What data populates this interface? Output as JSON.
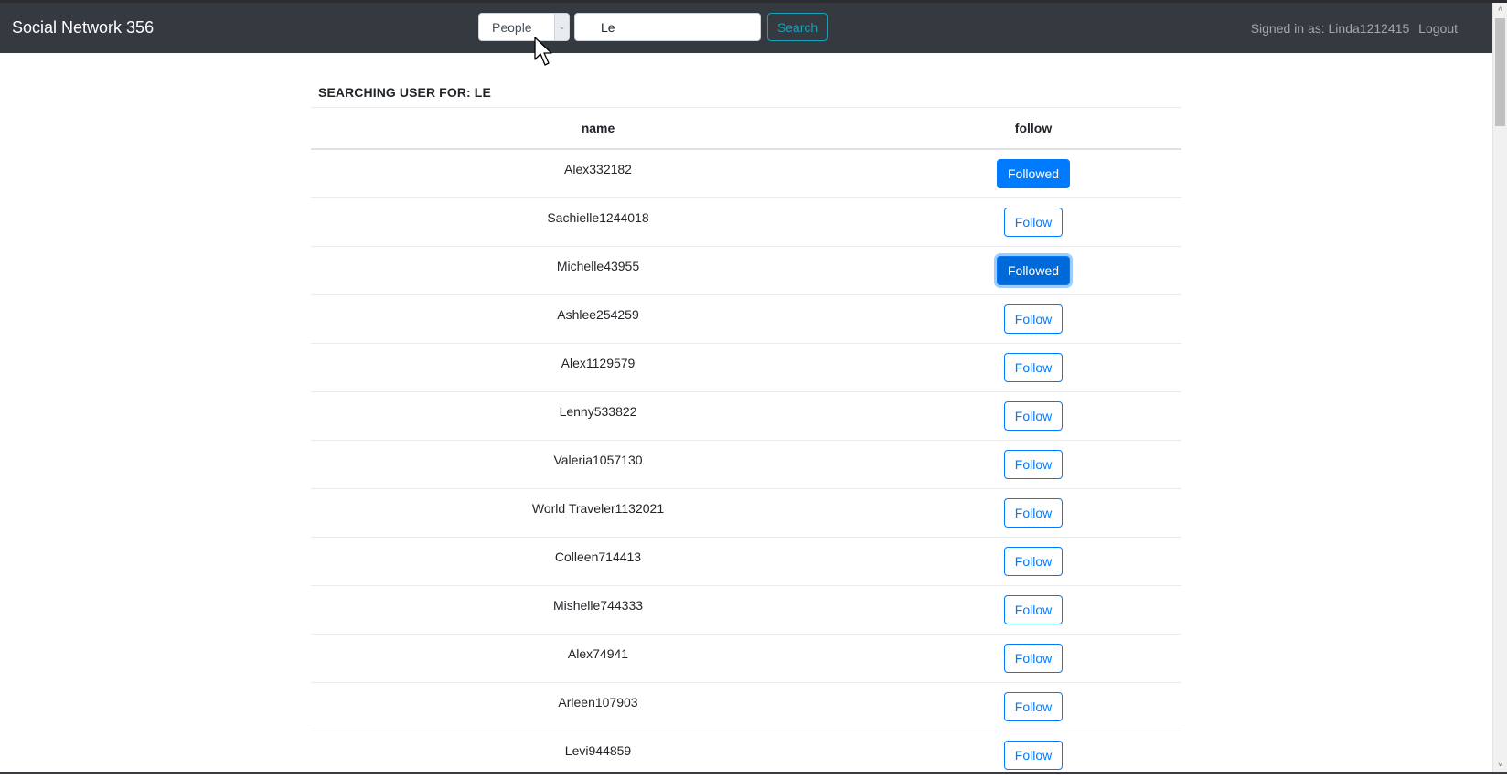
{
  "navbar": {
    "brand": "Social Network 356",
    "search_type": {
      "selected": "People"
    },
    "search_input": {
      "value": "Le",
      "placeholder": ""
    },
    "search_button": "Search",
    "signed_in_label": "Signed in as: Linda1212415",
    "logout": "Logout"
  },
  "main": {
    "title": "SEARCHING USER FOR: LE",
    "columns": [
      "name",
      "follow"
    ],
    "rows": [
      {
        "name": "Alex332182",
        "action": "Followed",
        "followed": true
      },
      {
        "name": "Sachielle1244018",
        "action": "Follow",
        "followed": false
      },
      {
        "name": "Michelle43955",
        "action": "Followed",
        "followed": true,
        "focused": true
      },
      {
        "name": "Ashlee254259",
        "action": "Follow",
        "followed": false
      },
      {
        "name": "Alex1129579",
        "action": "Follow",
        "followed": false
      },
      {
        "name": "Lenny533822",
        "action": "Follow",
        "followed": false
      },
      {
        "name": "Valeria1057130",
        "action": "Follow",
        "followed": false
      },
      {
        "name": "World Traveler1132021",
        "action": "Follow",
        "followed": false
      },
      {
        "name": "Colleen714413",
        "action": "Follow",
        "followed": false
      },
      {
        "name": "Mishelle744333",
        "action": "Follow",
        "followed": false
      },
      {
        "name": "Alex74941",
        "action": "Follow",
        "followed": false
      },
      {
        "name": "Arleen107903",
        "action": "Follow",
        "followed": false
      },
      {
        "name": "Levi944859",
        "action": "Follow",
        "followed": false
      }
    ]
  },
  "colors": {
    "navbar": "#343a40",
    "primary": "#007bff",
    "info": "#17a2b8"
  },
  "icons": {
    "select_arrow": "chevron-down-icon",
    "scroll_up": "chevron-up-icon",
    "scroll_down": "chevron-down-icon",
    "cursor": "mouse-pointer-icon"
  }
}
